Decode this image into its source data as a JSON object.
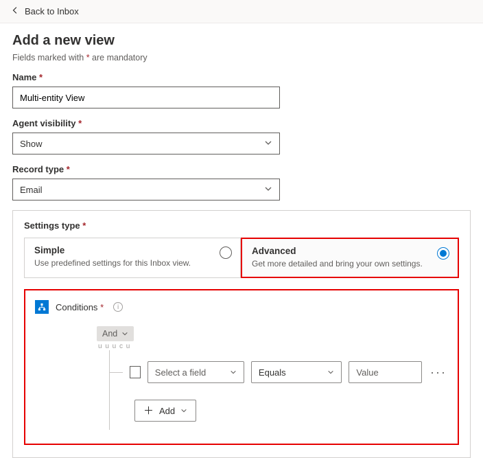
{
  "back_label": "Back to Inbox",
  "heading": "Add a new view",
  "mandatory_note_prefix": "Fields marked with ",
  "mandatory_note_star": "*",
  "mandatory_note_suffix": " are mandatory",
  "name": {
    "label": "Name",
    "value": "Multi-entity View"
  },
  "agent_visibility": {
    "label": "Agent visibility",
    "value": "Show"
  },
  "record_type": {
    "label": "Record type",
    "value": "Email"
  },
  "settings_type": {
    "label": "Settings type",
    "simple": {
      "title": "Simple",
      "desc": "Use predefined settings for this Inbox view."
    },
    "advanced": {
      "title": "Advanced",
      "desc": "Get more detailed and bring your own settings."
    },
    "selected": "advanced"
  },
  "conditions": {
    "title": "Conditions",
    "logic": "And",
    "row": {
      "field_placeholder": "Select a field",
      "operator": "Equals",
      "value_placeholder": "Value"
    },
    "add_label": "Add"
  }
}
